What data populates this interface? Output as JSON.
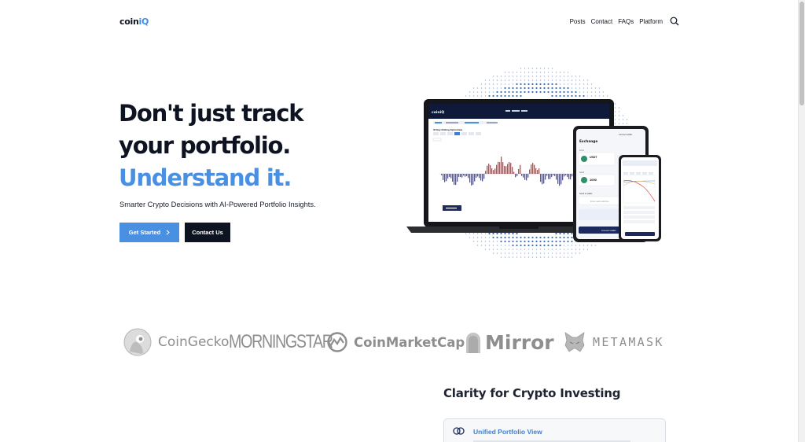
{
  "nav": {
    "logo_prefix": "coin",
    "logo_accent": "iQ",
    "links": [
      "Posts",
      "Contact",
      "FAQs",
      "Platform"
    ]
  },
  "hero": {
    "title_line1": "Don't just track",
    "title_line2": "your portfolio.",
    "title_line3": "Understand it.",
    "subtitle": "Smarter Crypto Decisions with AI-Powered Portfolio Insights.",
    "primary_button": "Get Started",
    "secondary_button": "Contact Us"
  },
  "mockup": {
    "laptop_logo": "coiniQ",
    "chart_title": "30 Day Rolling Alpha Beta",
    "exchange_title": "Exchange",
    "connect_wallet": "Connect wallet",
    "from_label": "From",
    "from_asset": "USDT",
    "send_label": "Send",
    "send_amount": "1000",
    "send_wallet_label": "Send to wallet",
    "wallet_placeholder": "Enter wallet address",
    "connect_button": "Connect wallet"
  },
  "partners": [
    "CoinGecko",
    "MORNINGSTAR",
    "CoinMarketCap",
    "Mirror",
    "METAMASK"
  ],
  "features": {
    "section_title": "Clarity for Crypto Investing",
    "items": [
      {
        "label": "Unified Portfolio View"
      }
    ]
  },
  "colors": {
    "accent": "#4a90e2",
    "dark": "#0d1321",
    "logo_gray": "#8e8e8e"
  }
}
